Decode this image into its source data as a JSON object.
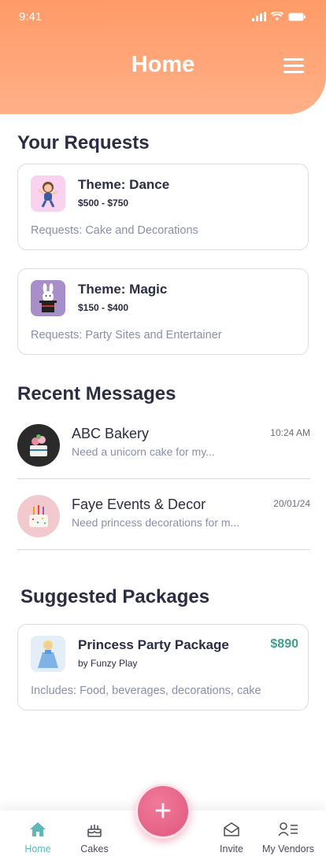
{
  "status": {
    "time": "9:41"
  },
  "header": {
    "title": "Home"
  },
  "requests": {
    "title": "Your Requests",
    "items": [
      {
        "theme": "Theme: Dance",
        "price": "$500 - $750",
        "requests": "Requests: Cake and Decorations",
        "icon": "dancing-girl-icon"
      },
      {
        "theme": "Theme: Magic",
        "price": "$150 - $400",
        "requests": "Requests: Party Sites and Entertainer",
        "icon": "magic-hat-rabbit-icon"
      }
    ]
  },
  "messages": {
    "title": "Recent Messages",
    "items": [
      {
        "name": "ABC Bakery",
        "preview": "Need a unicorn cake for my...",
        "time": "10:24 AM"
      },
      {
        "name": "Faye Events & Decor",
        "preview": "Need princess decorations for m...",
        "time": "20/01/24"
      }
    ]
  },
  "packages": {
    "title": "Suggested Packages",
    "items": [
      {
        "name": "Princess Party Package",
        "vendor": "by Funzy Play",
        "price": "$890",
        "includes": "Includes: Food, beverages, decorations, cake"
      }
    ]
  },
  "tabbar": {
    "home": "Home",
    "cakes": "Cakes",
    "invite": "Invite",
    "vendors": "My Vendors",
    "fab": "+"
  },
  "colors": {
    "accent": "#ff9a68",
    "active_tab": "#5fb8b6",
    "fab": "#e0577d",
    "price": "#3e9f8a"
  }
}
